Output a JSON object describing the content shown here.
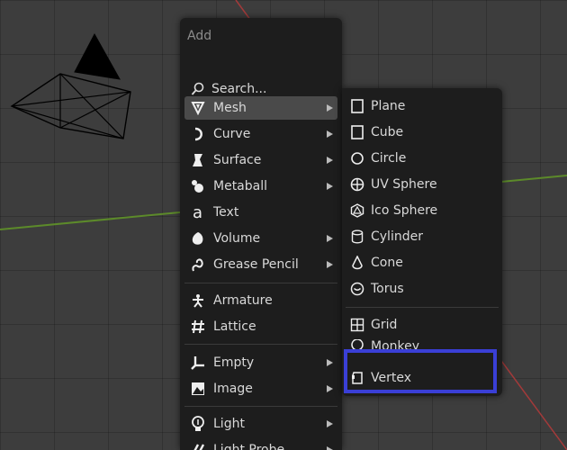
{
  "menu": {
    "title": "Add",
    "search_label": "Search...",
    "items": [
      {
        "label": "Mesh",
        "icon": "mesh-icon",
        "has_submenu": true,
        "active": true
      },
      {
        "label": "Curve",
        "icon": "curve-icon",
        "has_submenu": true
      },
      {
        "label": "Surface",
        "icon": "surface-icon",
        "has_submenu": true
      },
      {
        "label": "Metaball",
        "icon": "metaball-icon",
        "has_submenu": true
      },
      {
        "label": "Text",
        "icon": "text-icon",
        "has_submenu": false
      },
      {
        "label": "Volume",
        "icon": "volume-icon",
        "has_submenu": true
      },
      {
        "label": "Grease Pencil",
        "icon": "grease-pencil-icon",
        "has_submenu": true
      },
      {
        "label": "Armature",
        "icon": "armature-icon",
        "has_submenu": false
      },
      {
        "label": "Lattice",
        "icon": "lattice-icon",
        "has_submenu": false
      },
      {
        "label": "Empty",
        "icon": "empty-icon",
        "has_submenu": true
      },
      {
        "label": "Image",
        "icon": "image-icon",
        "has_submenu": true
      },
      {
        "label": "Light",
        "icon": "light-icon",
        "has_submenu": true
      },
      {
        "label": "Light Probe",
        "icon": "light-probe-icon",
        "has_submenu": true
      }
    ]
  },
  "submenu": {
    "items": [
      {
        "label": "Plane",
        "icon": "plane-icon"
      },
      {
        "label": "Cube",
        "icon": "cube-icon"
      },
      {
        "label": "Circle",
        "icon": "circle-icon"
      },
      {
        "label": "UV Sphere",
        "icon": "uv-sphere-icon"
      },
      {
        "label": "Ico Sphere",
        "icon": "ico-sphere-icon"
      },
      {
        "label": "Cylinder",
        "icon": "cylinder-icon"
      },
      {
        "label": "Cone",
        "icon": "cone-icon"
      },
      {
        "label": "Torus",
        "icon": "torus-icon"
      },
      {
        "label": "Grid",
        "icon": "grid-icon"
      },
      {
        "label": "Monkey",
        "icon": "monkey-icon"
      },
      {
        "label": "Vertex",
        "icon": "vertex-icon"
      }
    ]
  },
  "colors": {
    "menu_bg": "#1d1d1d",
    "active_bg": "#4a4a4a",
    "highlight_border": "#3a3fd6",
    "axis_red": "#a33a3a",
    "axis_green": "#5c8a2a"
  }
}
